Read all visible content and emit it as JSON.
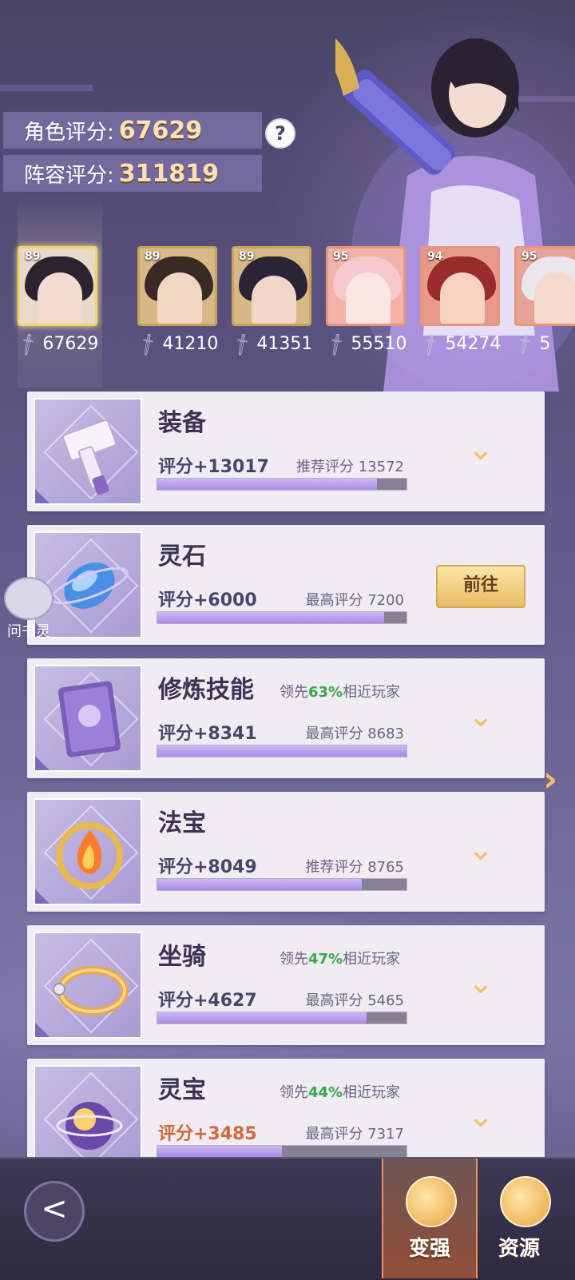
{
  "scores": {
    "role_label": "角色评分:",
    "role_value": "67629",
    "team_label": "阵容评分:",
    "team_value": "311819",
    "help": "?"
  },
  "team": [
    {
      "level": "89",
      "score": "67629"
    },
    {
      "level": "89",
      "score": "41210"
    },
    {
      "level": "89",
      "score": "41351"
    },
    {
      "level": "95",
      "score": "55510"
    },
    {
      "level": "94",
      "score": "54274"
    },
    {
      "level": "95",
      "score": "5"
    }
  ],
  "cards": [
    {
      "title": "装备",
      "lead_prefix": "",
      "lead_pct": "",
      "lead_suffix": "",
      "score": "评分+13017",
      "target": "推荐评分 13572",
      "progress": 0.88
    },
    {
      "title": "灵石",
      "lead_prefix": "",
      "lead_pct": "",
      "lead_suffix": "",
      "score": "评分+6000",
      "target": "最高评分 7200",
      "progress": 0.91,
      "button": "前往"
    },
    {
      "title": "修炼技能",
      "lead_prefix": "领先",
      "lead_pct": "63%",
      "lead_suffix": "相近玩家",
      "score": "评分+8341",
      "target": "最高评分 8683",
      "progress": 1.0
    },
    {
      "title": "法宝",
      "lead_prefix": "",
      "lead_pct": "",
      "lead_suffix": "",
      "score": "评分+8049",
      "target": "推荐评分 8765",
      "progress": 0.82
    },
    {
      "title": "坐骑",
      "lead_prefix": "领先",
      "lead_pct": "47%",
      "lead_suffix": "相近玩家",
      "score": "评分+4627",
      "target": "最高评分 5465",
      "progress": 0.84
    },
    {
      "title": "灵宝",
      "lead_prefix": "领先",
      "lead_pct": "44%",
      "lead_suffix": "相近玩家",
      "score": "评分+3485",
      "target": "最高评分 7317",
      "progress": 0.5
    }
  ],
  "helper_label": "问书灵",
  "nav": {
    "back": "<",
    "strong": "变强",
    "resource": "资源"
  },
  "colors": {
    "accent": "#f1c36a",
    "lead_green": "#3aa843",
    "bar_fill": "#a88be6"
  }
}
